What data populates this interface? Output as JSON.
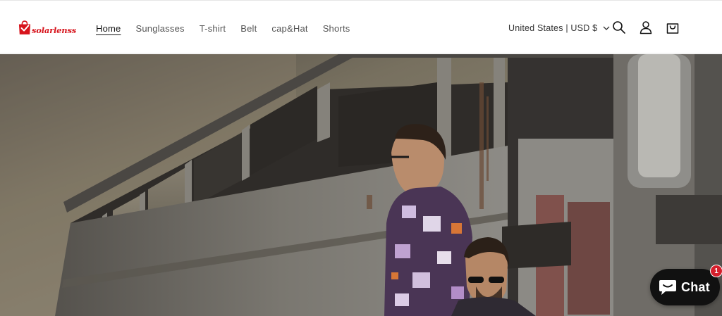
{
  "brand": {
    "name": "solarlenss",
    "accent_color": "#d7141c"
  },
  "nav": {
    "items": [
      {
        "label": "Home",
        "active": true
      },
      {
        "label": "Sunglasses",
        "active": false
      },
      {
        "label": "T-shirt",
        "active": false
      },
      {
        "label": "Belt",
        "active": false
      },
      {
        "label": "cap&Hat",
        "active": false
      },
      {
        "label": "Shorts",
        "active": false
      }
    ]
  },
  "header_actions": {
    "localization_label": "United States | USD $",
    "icons": [
      "chevron-down-icon",
      "search-icon",
      "account-icon",
      "cart-icon"
    ]
  },
  "hero": {
    "image": "two-men-with-sunglasses-beside-old-bus"
  },
  "chat": {
    "label": "Chat",
    "badge_count": "1",
    "badge_color": "#d61f2c"
  }
}
